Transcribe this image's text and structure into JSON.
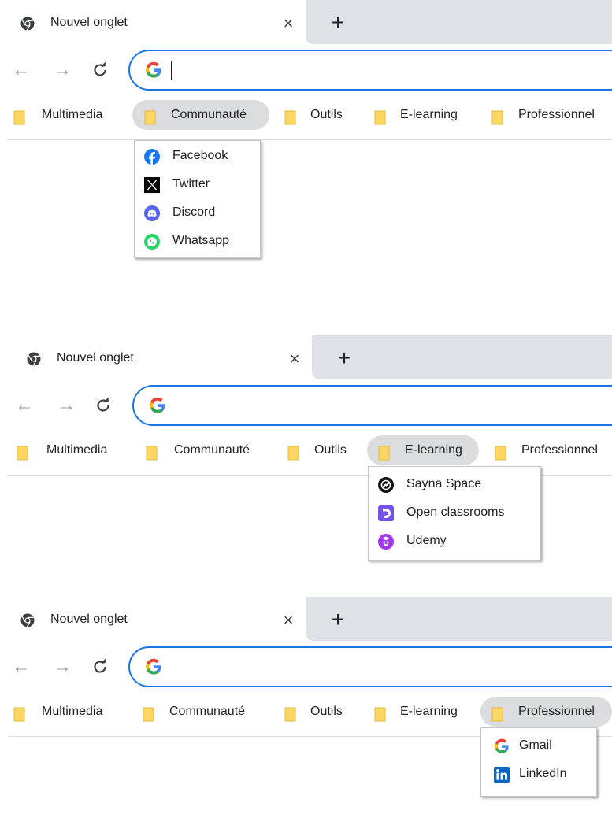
{
  "panels": [
    {
      "tab": {
        "title": "Nouvel onglet",
        "close": "×",
        "new_tab": "+"
      },
      "nav": {
        "back": "←",
        "forward": "→",
        "reload": "C"
      },
      "omnibox": {
        "engine_icon": "google-g-icon",
        "value": "",
        "focused": true
      },
      "bookmarks": [
        "Multimedia",
        "Communauté",
        "Outils",
        "E-learning",
        "Professionnel"
      ],
      "open_folder": "Communauté",
      "menu": [
        {
          "label": "Facebook",
          "icon": "facebook-icon"
        },
        {
          "label": "Twitter",
          "icon": "x-twitter-icon"
        },
        {
          "label": "Discord",
          "icon": "discord-icon"
        },
        {
          "label": "Whatsapp",
          "icon": "whatsapp-icon"
        }
      ]
    },
    {
      "tab": {
        "title": "Nouvel onglet",
        "close": "×",
        "new_tab": "+"
      },
      "nav": {
        "back": "←",
        "forward": "→",
        "reload": "C"
      },
      "omnibox": {
        "engine_icon": "google-g-icon",
        "value": "",
        "focused": true
      },
      "bookmarks": [
        "Multimedia",
        "Communauté",
        "Outils",
        "E-learning",
        "Professionnel"
      ],
      "open_folder": "E-learning",
      "menu": [
        {
          "label": "Sayna Space",
          "icon": "sayna-icon"
        },
        {
          "label": "Open classrooms",
          "icon": "openclassrooms-icon"
        },
        {
          "label": "Udemy",
          "icon": "udemy-icon"
        }
      ]
    },
    {
      "tab": {
        "title": "Nouvel onglet",
        "close": "×",
        "new_tab": "+"
      },
      "nav": {
        "back": "←",
        "forward": "→",
        "reload": "C"
      },
      "omnibox": {
        "engine_icon": "google-g-icon",
        "value": "",
        "focused": true
      },
      "bookmarks": [
        "Multimedia",
        "Communauté",
        "Outils",
        "E-learning",
        "Professionnel"
      ],
      "open_folder": "Professionnel",
      "menu": [
        {
          "label": "Gmail",
          "icon": "google-icon"
        },
        {
          "label": "LinkedIn",
          "icon": "linkedin-icon"
        }
      ]
    }
  ],
  "colors": {
    "accent": "#1a73e8",
    "folder": "#fdd663",
    "folder_edge": "#e6b93c",
    "tab_strip": "#dee1e6",
    "active_chip": "#dadce0"
  }
}
